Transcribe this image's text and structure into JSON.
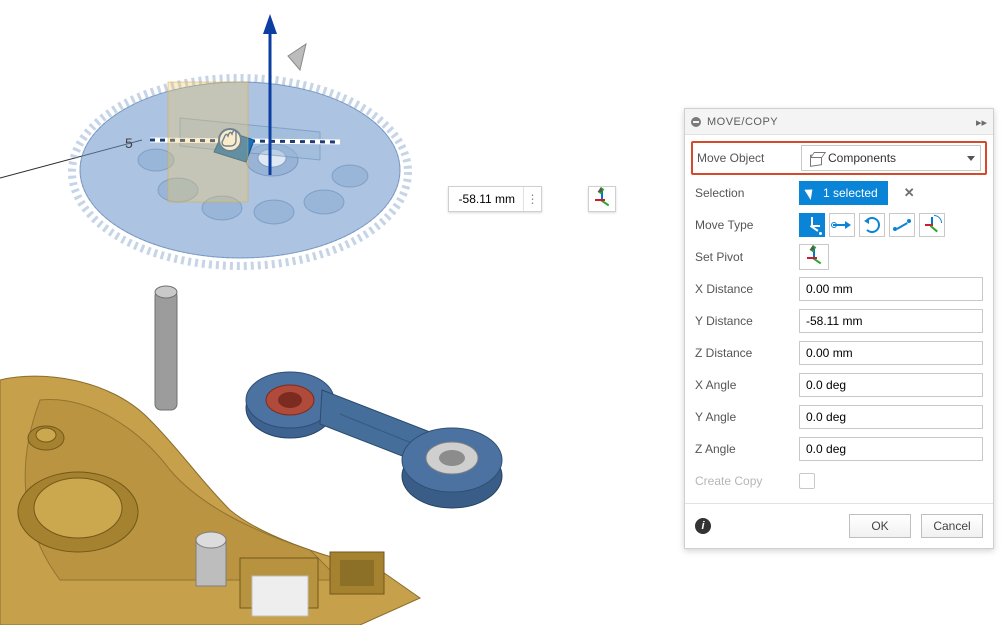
{
  "panel": {
    "title": "MOVE/COPY",
    "rows": {
      "move_object": {
        "label": "Move Object",
        "value": "Components"
      },
      "selection": {
        "label": "Selection",
        "chip": "1 selected"
      },
      "move_type": {
        "label": "Move Type"
      },
      "set_pivot": {
        "label": "Set Pivot"
      },
      "x_dist": {
        "label": "X Distance",
        "value": "0.00 mm"
      },
      "y_dist": {
        "label": "Y Distance",
        "value": "-58.11 mm"
      },
      "z_dist": {
        "label": "Z Distance",
        "value": "0.00 mm"
      },
      "x_ang": {
        "label": "X Angle",
        "value": "0.0 deg"
      },
      "y_ang": {
        "label": "Y Angle",
        "value": "0.0 deg"
      },
      "z_ang": {
        "label": "Z Angle",
        "value": "0.0 deg"
      },
      "create_copy": {
        "label": "Create Copy"
      }
    },
    "buttons": {
      "ok": "OK",
      "cancel": "Cancel"
    }
  },
  "viewport": {
    "callout_value": "-58.11 mm",
    "drag_label": "5"
  }
}
